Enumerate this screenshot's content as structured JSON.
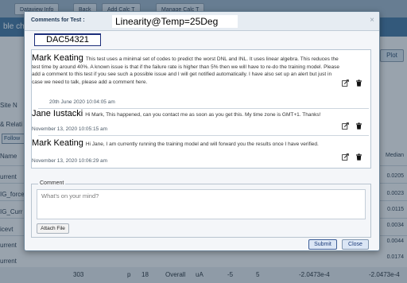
{
  "background": {
    "toolbar_buttons": [
      "Dataview Info",
      "Back",
      "Add Calc T",
      "Manage Calc T"
    ],
    "band_text": "ble cha",
    "plot_label": "Plot",
    "left_labels": [
      "Site N",
      "& Relati",
      "Name",
      "urrent",
      "IG_force",
      "IG_Curr",
      "icevt",
      "urrent",
      "urrent"
    ],
    "follow_label": "Follow",
    "right_labels": [
      "Median",
      "0.0205",
      "0.0023",
      "0.0115",
      "0.0034",
      "0.0044",
      "0.0174"
    ],
    "bottom_row": [
      "303",
      "p",
      "18",
      "Overall",
      "uA",
      "-5",
      "5",
      "-2.0473e-4",
      "-2.0473e-4"
    ],
    "colors": {
      "band": "#3b6f9c",
      "topbar": "#8fa9c0"
    }
  },
  "modal": {
    "title_prefix": "Comments for Test :",
    "title_value": "Linearity@Temp=25Deg",
    "close_icon": "×",
    "device_tab": "DAC54321",
    "comments": [
      {
        "author": "Mark Keating",
        "text": "This test uses a minimal set of codes to predict the worst DNL and INL. It uses linear algebra. This reduces the test time by around 40%. A known issue is that if the failure rate is higher than 5% then we will have to re-do the training model. Please add a comment to this test if you see such a possible issue and I will get notified automatically. I have also set up an alert but just in case we need to talk, please add a comment here.",
        "timestamp": "20th June 2020 10:04:05 am"
      },
      {
        "author": "Jane Iustacki",
        "text": "Hi Mark, This happened, can you contact me as soon as you get this. My time zone is GMT+1. Thanks!",
        "timestamp": "November 13, 2020 10:05:15 am"
      },
      {
        "author": "Mark Keating",
        "text": "Hi Jane, I am currently running the training model and will forward you the results once I have verified.",
        "timestamp": "November 13, 2020 10:06:29 am"
      }
    ],
    "comment_section": {
      "legend": "Comment",
      "placeholder": "What's on your mind?",
      "value": "",
      "attach_label": "Attach File"
    },
    "submit_label": "Submit",
    "close_label": "Close",
    "colors": {
      "accent": "#1c2e7a",
      "button_bg": "#dbe6f5"
    }
  }
}
